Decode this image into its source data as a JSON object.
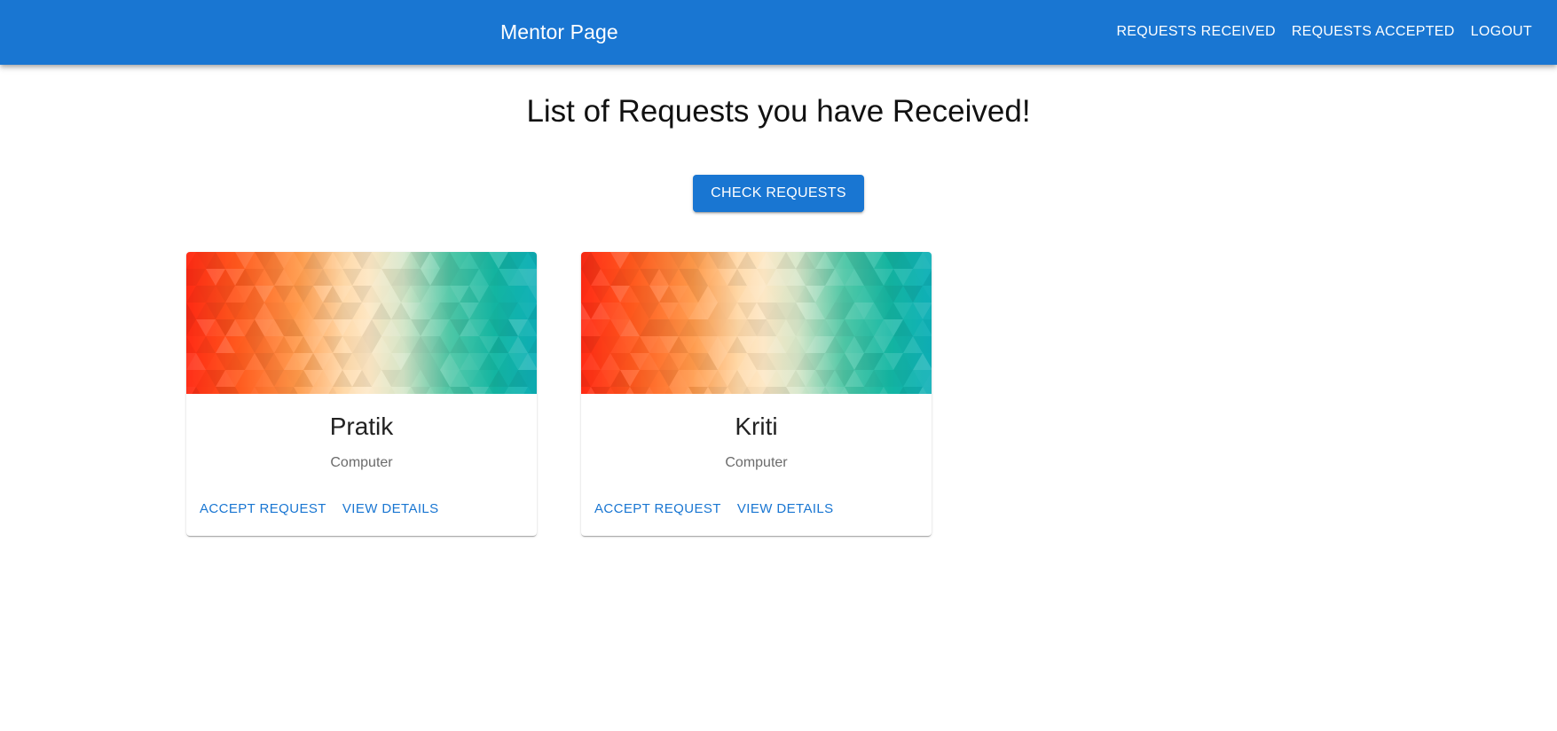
{
  "appbar": {
    "title": "Mentor Page",
    "nav": [
      {
        "label": "REQUESTS RECEIVED"
      },
      {
        "label": "REQUESTS ACCEPTED"
      },
      {
        "label": "LOGOUT"
      }
    ],
    "color": "#1976d2"
  },
  "main": {
    "heading": "List of Requests you have Received!",
    "check_button_label": "CHECK REQUESTS",
    "cards": [
      {
        "name": "Pratik",
        "department": "Computer",
        "actions": [
          {
            "label": "ACCEPT REQUEST"
          },
          {
            "label": "VIEW DETAILS"
          }
        ]
      },
      {
        "name": "Kriti",
        "department": "Computer",
        "actions": [
          {
            "label": "ACCEPT REQUEST"
          },
          {
            "label": "VIEW DETAILS"
          }
        ]
      }
    ]
  }
}
